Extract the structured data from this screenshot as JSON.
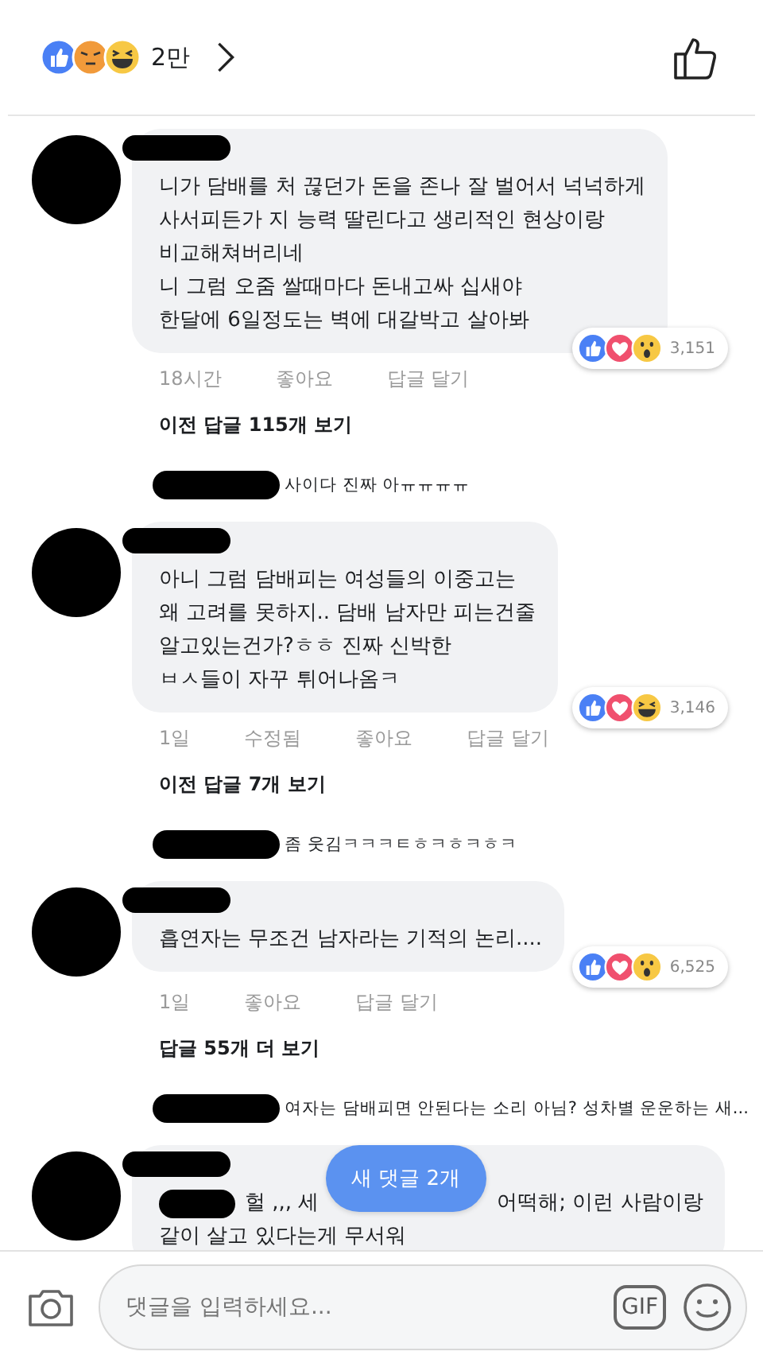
{
  "header": {
    "reactions": [
      {
        "kind": "like"
      },
      {
        "kind": "angry"
      },
      {
        "kind": "haha"
      }
    ],
    "count": "2만"
  },
  "comments": [
    {
      "lead_redacted": false,
      "lines": [
        [
          "니가 담배를 처 끊던가 돈을 존나 잘 벌어서 넉넉하게"
        ],
        [
          "사서피든가 지 능력 딸린다고 생리적인 현상이랑"
        ],
        [
          "비교해쳐버리네"
        ],
        [
          "니 그럼 오줌 쌀때마다 돈내고싸 십새야"
        ],
        [
          "한달에 6일정도는 벽에 대갈박고 살아봐"
        ]
      ],
      "reactions": {
        "icons": [
          {
            "kind": "like"
          },
          {
            "kind": "love"
          },
          {
            "kind": "wow"
          }
        ],
        "count": "3,151"
      },
      "meta": [
        "18시간",
        "좋아요",
        "답글 달기"
      ],
      "replies_link": "이전 답글 115개 보기",
      "reply_preview": "사이다 진짜 아ㅠㅠㅠㅠ"
    },
    {
      "lead_redacted": false,
      "lines": [
        [
          "아니 그럼 담배피는 여성들의 이중고는"
        ],
        [
          "왜 고려를 못하지.. 담배 남자만 피는건줄"
        ],
        [
          "알고있는건가?ㅎㅎ 진짜 신박한"
        ],
        [
          "ㅂㅅ들이 자꾸 튀어나옴ㅋ"
        ]
      ],
      "reactions": {
        "icons": [
          {
            "kind": "like"
          },
          {
            "kind": "love"
          },
          {
            "kind": "haha"
          }
        ],
        "count": "3,146"
      },
      "meta": [
        "1일",
        "수정됨",
        "좋아요",
        "답글 달기"
      ],
      "replies_link": "이전 답글 7개 보기",
      "reply_preview": "좀 웃김ㅋㅋㅋㅌㅎㅋㅎㅋㅎㅋ"
    },
    {
      "lead_redacted": false,
      "lines": [
        [
          "흡연자는 무조건 남자라는 기적의 논리...."
        ]
      ],
      "reactions": {
        "icons": [
          {
            "kind": "like"
          },
          {
            "kind": "love"
          },
          {
            "kind": "wow"
          }
        ],
        "count": "6,525"
      },
      "meta": [
        "1일",
        "좋아요",
        "답글 달기"
      ],
      "replies_link": "답글 55개 더 보기",
      "reply_preview": "여자는 담배피면 안된다는 소리 아님? 성차별 운운하는 새..."
    },
    {
      "lead_redacted": true,
      "lines": [
        [
          "헐 ,,, 세",
          "어떡해; 이런 사람이랑"
        ],
        [
          "같이 살고 있다는게 무서워"
        ]
      ]
    }
  ],
  "new_comments_pill": "새 댓글 2개",
  "composer": {
    "placeholder": "댓글을 입력하세요...",
    "gif_label": "GIF"
  }
}
